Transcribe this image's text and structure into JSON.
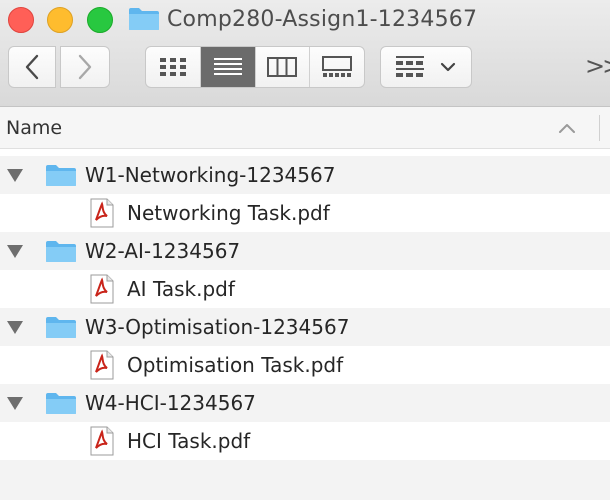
{
  "window": {
    "title": "Comp280-Assign1-1234567",
    "title_icon": "folder-icon",
    "traffic_lights": {
      "close": "#ff5f57",
      "minimize": "#febc2e",
      "maximize": "#28c840"
    }
  },
  "toolbar": {
    "back_icon": "chevron-left-icon",
    "forward_icon": "chevron-right-icon",
    "view_modes": [
      "icon-view",
      "list-view",
      "column-view",
      "gallery-view"
    ],
    "active_view": "list-view",
    "group_icon": "group-by-icon",
    "overflow_icon": "double-chevron-right-icon",
    "overflow_label": ">>"
  },
  "list_header": {
    "name_label": "Name",
    "sort_icon": "chevron-up-icon"
  },
  "folders": [
    {
      "name": "W1-Networking-1234567",
      "expanded": true,
      "files": [
        {
          "name": "Networking Task.pdf",
          "icon": "pdf-icon"
        }
      ]
    },
    {
      "name": "W2-AI-1234567",
      "expanded": true,
      "files": [
        {
          "name": "AI Task.pdf",
          "icon": "pdf-icon"
        }
      ]
    },
    {
      "name": "W3-Optimisation-1234567",
      "expanded": true,
      "files": [
        {
          "name": "Optimisation Task.pdf",
          "icon": "pdf-icon"
        }
      ]
    },
    {
      "name": "W4-HCI-1234567",
      "expanded": true,
      "files": [
        {
          "name": "HCI Task.pdf",
          "icon": "pdf-icon"
        }
      ]
    }
  ],
  "colors": {
    "folder": "#7cc8f4",
    "pdf_red": "#c9241a",
    "stripe": "#f3f3f3",
    "active_segment": "#6b6b6b"
  }
}
